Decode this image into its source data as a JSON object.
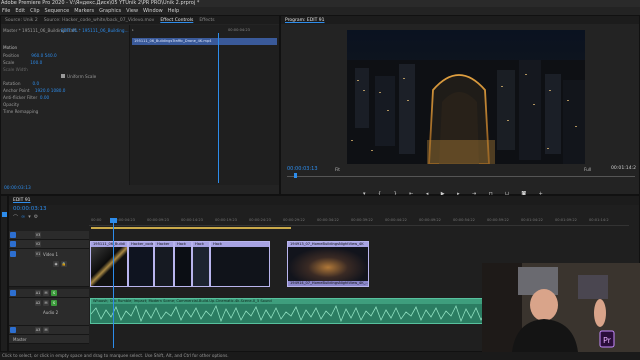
{
  "app": {
    "title": "Adobe Premiere Pro 2020 - V:\\Яндекс.Диск\\05 YTUnik 2\\PR PRO\\Unik 2.prproj *"
  },
  "menu": [
    "File",
    "Edit",
    "Clip",
    "Sequence",
    "Markers",
    "Graphics",
    "View",
    "Window",
    "Help"
  ],
  "source_panel": {
    "tabs": [
      "Source: Unik 2",
      "Source: Hacker_code_white/back_07_Videvo.mov",
      "Effect Controls",
      "Effects"
    ],
    "active_tab": "Effect Controls",
    "master_label": "Master * 195111_06_BuildingsTraff...",
    "clip_label": "EDIT 91 * 195111_06_Building...",
    "section_label": "Motion",
    "properties": [
      {
        "name": "Position",
        "value": "960.0    540.0"
      },
      {
        "name": "Scale",
        "value": "100.0"
      },
      {
        "name": "Scale Width",
        "value": ""
      },
      {
        "name": "Uniform Scale",
        "value": ""
      },
      {
        "name": "Rotation",
        "value": "0.0"
      },
      {
        "name": "Anchor Point",
        "value": "1920.0    1080.0"
      },
      {
        "name": "Anti-flicker Filter",
        "value": "0.00"
      },
      {
        "name": "Opacity",
        "value": ""
      },
      {
        "name": "Time Remapping",
        "value": ""
      }
    ],
    "mini_timecode": "00:00:04:23",
    "mini_clip_label": "195111_06_BuildingsTraffic_Drone_4K.mp4",
    "footer_timecode": "00:00:03:13"
  },
  "program_panel": {
    "tab": "Program: EDIT 91",
    "timecode": "00:00:03:13",
    "fit": "Fit",
    "quality": "Full",
    "duration": "00:01:14:2"
  },
  "timeline": {
    "tab": "EDIT 91",
    "timecode": "00:00:03:13",
    "ruler": [
      "00:00",
      "00:00:04:23",
      "00:00:09:23",
      "00:00:14:23",
      "00:00:19:23",
      "00:00:24:23",
      "00:00:29:22",
      "00:00:34:22",
      "00:00:39:22",
      "00:00:44:22",
      "00:00:49:22",
      "00:00:54:22",
      "00:00:59:22",
      "00:01:04:22",
      "00:01:09:22",
      "00:01:14:2"
    ],
    "tracks": [
      {
        "id": "V3",
        "name": ""
      },
      {
        "id": "V2",
        "name": ""
      },
      {
        "id": "V1",
        "name": "Video 1"
      },
      {
        "id": "A1",
        "name": ""
      },
      {
        "id": "A2",
        "name": "Audio 2"
      },
      {
        "id": "A3",
        "name": ""
      },
      {
        "id": "Master",
        "name": "Master"
      }
    ],
    "video_clips": [
      "195111_06_Buildi",
      "Hacker_code",
      "Hacker",
      "Hack",
      "Hack",
      "Hack",
      "194913_07_HomeBuildingsNightView_4K",
      "194914_07_HomeBuildingsNightView_4K_..."
    ],
    "audio_clip": "Whoosh; Sub Rumble; Impact; Modern Scene; Commercial-Build-Up-Cinematic-4k-Scene-0_5 Sound"
  },
  "status_bar": "Click to select, or click in empty space and drag to marquee select. Use Shift, Alt, and Ctrl for other options.",
  "colors": {
    "accent": "#2d8ceb",
    "video_clip": "#8a86c9",
    "audio_clip": "#2b7d62",
    "panel": "#232323"
  }
}
